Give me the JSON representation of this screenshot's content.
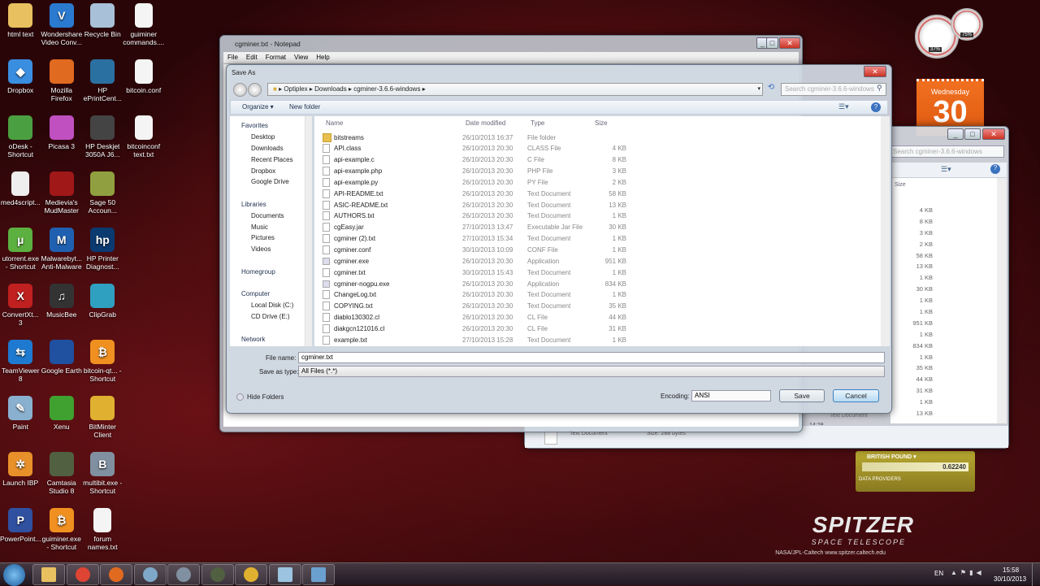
{
  "desktop_icons": [
    {
      "label": "html text",
      "color": "#e8c060",
      "glyph": ""
    },
    {
      "label": "Dropbox",
      "color": "#3a8ee0",
      "glyph": "◆"
    },
    {
      "label": "oDesk - Shortcut",
      "color": "#4aa040",
      "glyph": ""
    },
    {
      "label": "med4script...",
      "color": "#eeeeee",
      "glyph": ""
    },
    {
      "label": "utorrent.exe - Shortcut",
      "color": "#5cb040",
      "glyph": "µ"
    },
    {
      "label": "ConvertXt... 3",
      "color": "#c02020",
      "glyph": "X"
    },
    {
      "label": "TeamViewer 8",
      "color": "#1e7ad0",
      "glyph": "⇆"
    },
    {
      "label": "Paint",
      "color": "#8ab0d0",
      "glyph": "✎"
    },
    {
      "label": "Launch IBP",
      "color": "#e8902a",
      "glyph": "✲"
    },
    {
      "label": "PowerPoint...",
      "color": "#3050a0",
      "glyph": "P"
    },
    {
      "label": "Wondershare Video Conv...",
      "color": "#2a7ad0",
      "glyph": "V"
    },
    {
      "label": "Mozilla Firefox",
      "color": "#e06a20",
      "glyph": ""
    },
    {
      "label": "Picasa 3",
      "color": "#c050c0",
      "glyph": ""
    },
    {
      "label": "Medievia's MudMaster",
      "color": "#a01818",
      "glyph": ""
    },
    {
      "label": "Malwarebyt... Anti-Malware",
      "color": "#2060b0",
      "glyph": "M"
    },
    {
      "label": "MusicBee",
      "color": "#333333",
      "glyph": "♫"
    },
    {
      "label": "Google Earth",
      "color": "#2050a0",
      "glyph": ""
    },
    {
      "label": "Xenu",
      "color": "#40a030",
      "glyph": ""
    },
    {
      "label": "Camtasia Studio 8",
      "color": "#506040",
      "glyph": ""
    },
    {
      "label": "guiminer.exe - Shortcut",
      "color": "#f09020",
      "glyph": "₿"
    },
    {
      "label": "Recycle Bin",
      "color": "#a8c0d8",
      "glyph": ""
    },
    {
      "label": "HP ePrintCent...",
      "color": "#2a70a0",
      "glyph": ""
    },
    {
      "label": "HP Deskjet 3050A J6...",
      "color": "#444444",
      "glyph": ""
    },
    {
      "label": "Sage 50 Accoun...",
      "color": "#90a040",
      "glyph": ""
    },
    {
      "label": "HP Printer Diagnost...",
      "color": "#0a3a70",
      "glyph": "hp"
    },
    {
      "label": "ClipGrab",
      "color": "#30a0c0",
      "glyph": ""
    },
    {
      "label": "bitcoin-qt... - Shortcut",
      "color": "#f09020",
      "glyph": "₿"
    },
    {
      "label": "BitMinter Client",
      "color": "#e0b030",
      "glyph": ""
    },
    {
      "label": "multibit.exe - Shortcut",
      "color": "#8090a0",
      "glyph": "B"
    },
    {
      "label": "forum names.txt",
      "color": "#f4f4f4",
      "glyph": ""
    },
    {
      "label": "guiminer commands....",
      "color": "#f4f4f4",
      "glyph": ""
    },
    {
      "label": "bitcoin.conf",
      "color": "#f4f4f4",
      "glyph": ""
    },
    {
      "label": "bitcoinconf text.txt",
      "color": "#f4f4f4",
      "glyph": ""
    }
  ],
  "notepad": {
    "title": "cgminer.txt - Notepad",
    "menu": [
      "File",
      "Edit",
      "Format",
      "View",
      "Help"
    ]
  },
  "save_as": {
    "title": "Save As",
    "breadcrumb": [
      "Optiplex",
      "Downloads",
      "cgminer-3.6.6-windows"
    ],
    "search_placeholder": "Search cgminer-3.6.6-windows",
    "organize": "Organize ▾",
    "new_folder": "New folder",
    "nav": {
      "favorites": [
        "Favorites",
        "Desktop",
        "Downloads",
        "Recent Places",
        "Dropbox",
        "Google Drive"
      ],
      "libraries": [
        "Libraries",
        "Documents",
        "Music",
        "Pictures",
        "Videos"
      ],
      "homegroup": "Homegroup",
      "computer": [
        "Computer",
        "Local Disk (C:)",
        "CD Drive (E:)"
      ],
      "network": "Network"
    },
    "columns": {
      "name": "Name",
      "date": "Date modified",
      "type": "Type",
      "size": "Size"
    },
    "files": [
      {
        "name": "bitstreams",
        "date": "26/10/2013 16:37",
        "type": "File folder",
        "size": "",
        "kind": "folder"
      },
      {
        "name": "API.class",
        "date": "26/10/2013 20:30",
        "type": "CLASS File",
        "size": "4 KB",
        "kind": "file"
      },
      {
        "name": "api-example.c",
        "date": "26/10/2013 20:30",
        "type": "C File",
        "size": "8 KB",
        "kind": "file"
      },
      {
        "name": "api-example.php",
        "date": "26/10/2013 20:30",
        "type": "PHP File",
        "size": "3 KB",
        "kind": "file"
      },
      {
        "name": "api-example.py",
        "date": "26/10/2013 20:30",
        "type": "PY File",
        "size": "2 KB",
        "kind": "file"
      },
      {
        "name": "API-README.txt",
        "date": "26/10/2013 20:30",
        "type": "Text Document",
        "size": "58 KB",
        "kind": "file"
      },
      {
        "name": "ASIC-README.txt",
        "date": "26/10/2013 20:30",
        "type": "Text Document",
        "size": "13 KB",
        "kind": "file"
      },
      {
        "name": "AUTHORS.txt",
        "date": "26/10/2013 20:30",
        "type": "Text Document",
        "size": "1 KB",
        "kind": "file"
      },
      {
        "name": "cgEasy.jar",
        "date": "27/10/2013 13:47",
        "type": "Executable Jar File",
        "size": "30 KB",
        "kind": "file"
      },
      {
        "name": "cgminer (2).txt",
        "date": "27/10/2013 15:34",
        "type": "Text Document",
        "size": "1 KB",
        "kind": "file"
      },
      {
        "name": "cgminer.conf",
        "date": "30/10/2013 10:09",
        "type": "CONF File",
        "size": "1 KB",
        "kind": "file"
      },
      {
        "name": "cgminer.exe",
        "date": "26/10/2013 20:30",
        "type": "Application",
        "size": "951 KB",
        "kind": "app"
      },
      {
        "name": "cgminer.txt",
        "date": "30/10/2013 15:43",
        "type": "Text Document",
        "size": "1 KB",
        "kind": "file"
      },
      {
        "name": "cgminer-nogpu.exe",
        "date": "26/10/2013 20:30",
        "type": "Application",
        "size": "834 KB",
        "kind": "app"
      },
      {
        "name": "ChangeLog.txt",
        "date": "26/10/2013 20:30",
        "type": "Text Document",
        "size": "1 KB",
        "kind": "file"
      },
      {
        "name": "COPYING.txt",
        "date": "26/10/2013 20:30",
        "type": "Text Document",
        "size": "35 KB",
        "kind": "file"
      },
      {
        "name": "diablo130302.cl",
        "date": "26/10/2013 20:30",
        "type": "CL File",
        "size": "44 KB",
        "kind": "file"
      },
      {
        "name": "diakgcn121016.cl",
        "date": "26/10/2013 20:30",
        "type": "CL File",
        "size": "31 KB",
        "kind": "file"
      },
      {
        "name": "example.txt",
        "date": "27/10/2013 15:28",
        "type": "Text Document",
        "size": "1 KB",
        "kind": "file"
      }
    ],
    "file_name_label": "File name:",
    "file_name": "cgminer.txt",
    "save_type_label": "Save as type:",
    "save_type": "All Files  (*.*)",
    "hide_folders": "Hide Folders",
    "encoding_label": "Encoding:",
    "encoding": "ANSI",
    "save": "Save",
    "cancel": "Cancel"
  },
  "explorer_bg": {
    "search": "Search cgminer-3.6.6-windows",
    "size_header": "Size",
    "sizes": [
      "4 KB",
      "8 KB",
      "3 KB",
      "2 KB",
      "58 KB",
      "13 KB",
      "1 KB",
      "30 KB",
      "1 KB",
      "1 KB",
      "951 KB",
      "1 KB",
      "834 KB",
      "1 KB",
      "35 KB",
      "44 KB",
      "31 KB",
      "1 KB",
      "13 KB"
    ],
    "status_type": "Text Document",
    "status_size": "Size: 288 bytes",
    "time_fragment": "14:28",
    "type_fragment": "Text Document"
  },
  "gadgets": {
    "cpu": "37%",
    "mem": "75%",
    "day_name": "Wednesday",
    "day_num": "30",
    "currency": "BRITISH POUND ▾",
    "rate": "0.62240",
    "providers": "DATA PROVIDERS"
  },
  "wallpaper": {
    "logo": "SPITZER",
    "logo_sub": "SPACE TELESCOPE",
    "credit": "NASA/JPL-Caltech   www.spitzer.caltech.edu"
  },
  "taskbar": {
    "apps": [
      {
        "name": "windows-explorer",
        "color": "#e8c060"
      },
      {
        "name": "chrome",
        "color": "#dd4433"
      },
      {
        "name": "firefox",
        "color": "#e06a20"
      },
      {
        "name": "app-window",
        "color": "#7fa8c8"
      },
      {
        "name": "multibit",
        "color": "#8090a0"
      },
      {
        "name": "camtasia",
        "color": "#506040"
      },
      {
        "name": "bitminter",
        "color": "#e0b030"
      },
      {
        "name": "notepad",
        "color": "#9cc4e0"
      },
      {
        "name": "explorer-window",
        "color": "#6aa0d0"
      }
    ],
    "lang": "EN",
    "time": "15:58",
    "date": "30/10/2013"
  }
}
